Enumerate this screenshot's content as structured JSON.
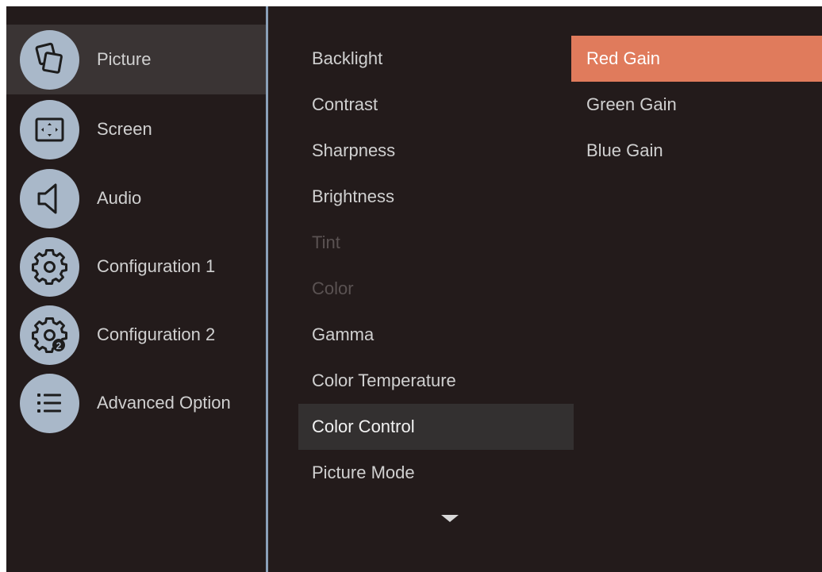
{
  "sidebar": {
    "items": [
      {
        "label": "Picture",
        "icon": "picture-icon",
        "active": true
      },
      {
        "label": "Screen",
        "icon": "screen-icon",
        "active": false
      },
      {
        "label": "Audio",
        "icon": "speaker-icon",
        "active": false
      },
      {
        "label": "Configuration 1",
        "icon": "gear-icon",
        "active": false
      },
      {
        "label": "Configuration 2",
        "icon": "gear-2-icon",
        "active": false
      },
      {
        "label": "Advanced Option",
        "icon": "list-icon",
        "active": false
      }
    ]
  },
  "picture_menu": {
    "items": [
      {
        "label": "Backlight",
        "state": "enabled"
      },
      {
        "label": "Contrast",
        "state": "enabled"
      },
      {
        "label": "Sharpness",
        "state": "enabled"
      },
      {
        "label": "Brightness",
        "state": "enabled"
      },
      {
        "label": "Tint",
        "state": "disabled"
      },
      {
        "label": "Color",
        "state": "disabled"
      },
      {
        "label": "Gamma",
        "state": "enabled"
      },
      {
        "label": "Color Temperature",
        "state": "enabled"
      },
      {
        "label": "Color Control",
        "state": "selected"
      },
      {
        "label": "Picture Mode",
        "state": "enabled"
      }
    ],
    "more_indicator": "chevron-down-icon"
  },
  "color_control_menu": {
    "items": [
      {
        "label": "Red Gain",
        "state": "focused"
      },
      {
        "label": "Green Gain",
        "state": "enabled"
      },
      {
        "label": "Blue Gain",
        "state": "enabled"
      }
    ]
  },
  "colors": {
    "background": "#231b1b",
    "focus_highlight": "#e07b5c",
    "icon_circle": "#a9b8c9",
    "divider": "#8aa0b8"
  }
}
